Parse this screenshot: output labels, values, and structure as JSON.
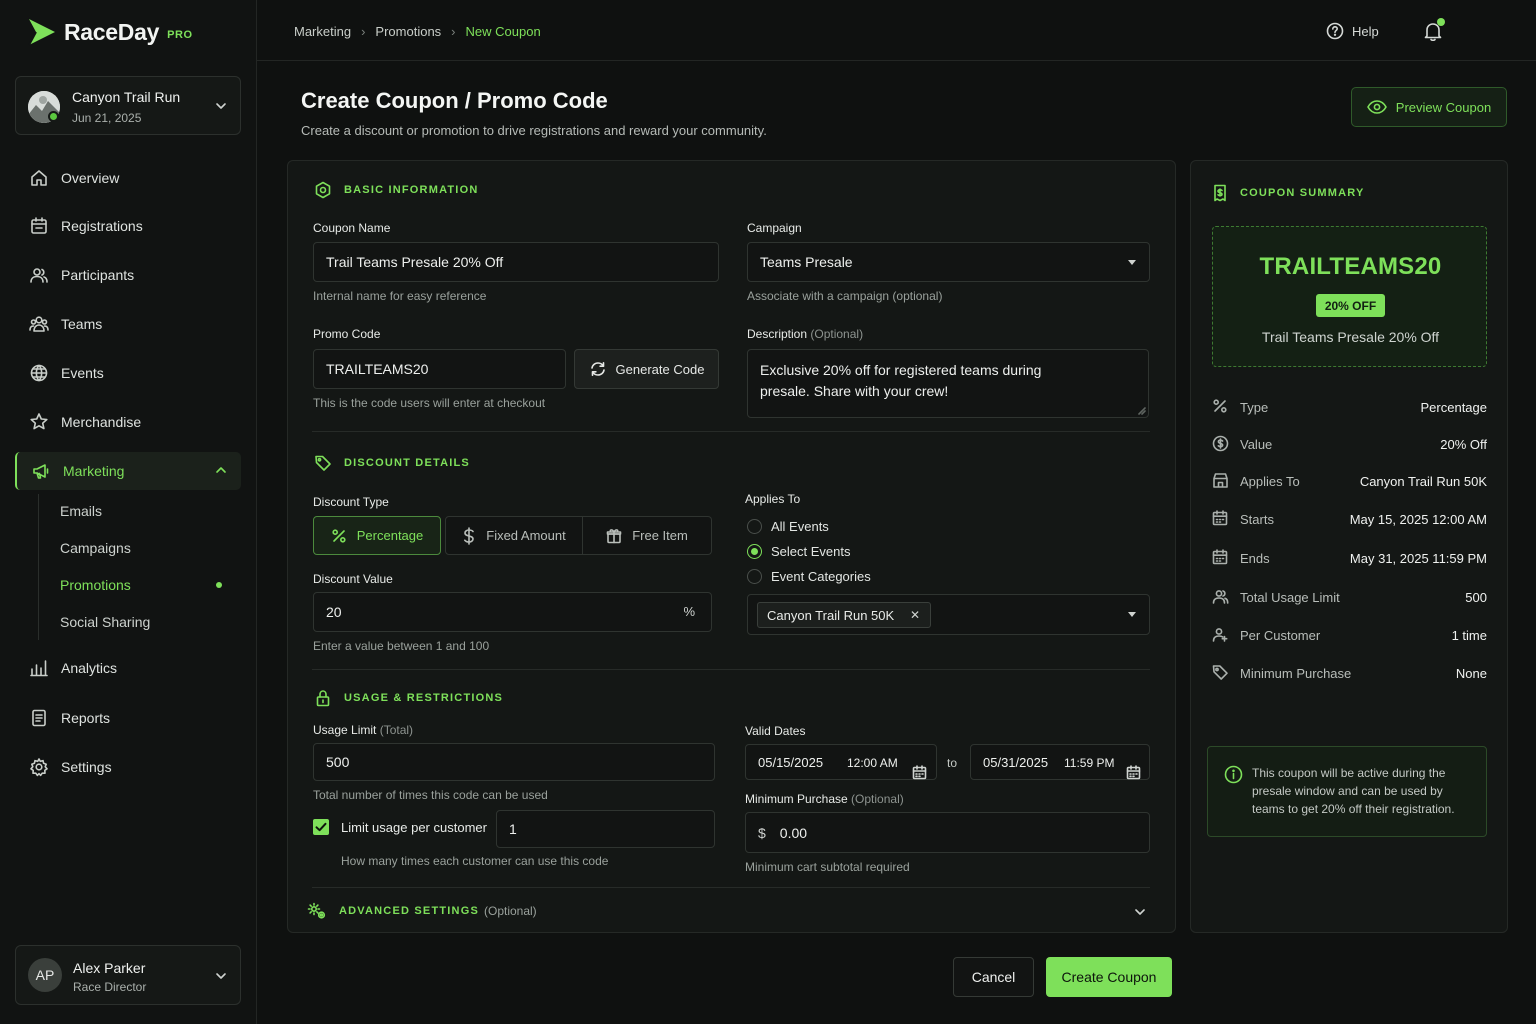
{
  "app": {
    "name": "RaceDay",
    "badge": "PRO"
  },
  "event": {
    "name": "Canyon Trail Run",
    "date": "Jun 21, 2025"
  },
  "nav": {
    "items": [
      {
        "label": "Overview",
        "icon": "home-icon"
      },
      {
        "label": "Registrations",
        "icon": "calendar-icon"
      },
      {
        "label": "Participants",
        "icon": "users-icon"
      },
      {
        "label": "Teams",
        "icon": "team-icon"
      },
      {
        "label": "Events",
        "icon": "globe-icon"
      },
      {
        "label": "Merchandise",
        "icon": "star-badge-icon"
      },
      {
        "label": "Marketing",
        "icon": "megaphone-icon"
      },
      {
        "label": "Analytics",
        "icon": "bar-chart-icon"
      },
      {
        "label": "Reports",
        "icon": "report-icon"
      },
      {
        "label": "Settings",
        "icon": "gear-icon"
      }
    ],
    "marketing_sub": [
      "Emails",
      "Campaigns",
      "Promotions",
      "Social Sharing"
    ]
  },
  "user": {
    "initials": "AP",
    "name": "Alex Parker",
    "role": "Race Director"
  },
  "breadcrumb": [
    "Marketing",
    "Promotions",
    "New Coupon"
  ],
  "topbar": {
    "help": "Help"
  },
  "page": {
    "title": "Create Coupon / Promo Code",
    "subtitle": "Create a discount or promotion to drive registrations and reward your community.",
    "preview_button": "Preview Coupon"
  },
  "basic": {
    "heading": "BASIC INFORMATION",
    "coupon_name_label": "Coupon Name",
    "coupon_name_value": "Trail Teams Presale 20% Off",
    "coupon_name_hint": "Internal name for easy reference",
    "campaign_label": "Campaign",
    "campaign_value": "Teams Presale",
    "campaign_hint": "Associate with a campaign (optional)",
    "promo_label": "Promo Code",
    "promo_value": "TRAILTEAMS20",
    "promo_hint": "This is the code users will enter at checkout",
    "generate_button": "Generate Code",
    "description_label": "Description",
    "description_opt": "(Optional)",
    "description_line1": "Exclusive 20% off for registered teams during",
    "description_line2": "presale. Share with your crew!"
  },
  "discount": {
    "heading": "DISCOUNT DETAILS",
    "type_label": "Discount Type",
    "types": [
      "Percentage",
      "Fixed Amount",
      "Free Item"
    ],
    "selected_type": "Percentage",
    "value_label": "Discount Value",
    "value": "20",
    "value_unit": "%",
    "value_hint": "Enter a value between 1 and 100",
    "applies_label": "Applies To",
    "applies_options": [
      "All Events",
      "Select Events",
      "Event Categories"
    ],
    "applies_selected": "Select Events",
    "selected_event_chip": "Canyon Trail Run 50K"
  },
  "usage": {
    "heading": "USAGE & RESTRICTIONS",
    "limit_label": "Usage Limit",
    "limit_opt": "(Total)",
    "limit_value": "500",
    "limit_hint": "Total number of times this code can be used",
    "per_customer_label": "Limit usage per customer",
    "per_customer_checked": true,
    "per_customer_value": "1",
    "per_customer_hint": "How many times each customer can use this code",
    "valid_label": "Valid Dates",
    "start_date": "05/15/2025",
    "start_time": "12:00 AM",
    "to": "to",
    "end_date": "05/31/2025",
    "end_time": "11:59 PM",
    "min_label": "Minimum Purchase",
    "min_opt": "(Optional)",
    "min_currency": "$",
    "min_value": "0.00",
    "min_hint": "Minimum cart subtotal required"
  },
  "advanced": {
    "heading": "ADVANCED SETTINGS",
    "opt": "(Optional)"
  },
  "summary": {
    "heading": "COUPON SUMMARY",
    "code": "TRAILTEAMS20",
    "badge": "20% OFF",
    "name": "Trail Teams Presale 20% Off",
    "rows": [
      {
        "key": "Type",
        "value": "Percentage",
        "icon": "percent-icon"
      },
      {
        "key": "Value",
        "value": "20% Off",
        "icon": "dollar-circle-icon"
      },
      {
        "key": "Applies To",
        "value": "Canyon Trail Run 50K",
        "icon": "store-icon"
      },
      {
        "key": "Starts",
        "value": "May 15, 2025 12:00 AM",
        "icon": "calendar-icon"
      },
      {
        "key": "Ends",
        "value": "May 31, 2025 11:59 PM",
        "icon": "calendar-icon"
      },
      {
        "key": "Total Usage Limit",
        "value": "500",
        "icon": "users-icon"
      },
      {
        "key": "Per Customer",
        "value": "1 time",
        "icon": "user-icon"
      },
      {
        "key": "Minimum Purchase",
        "value": "None",
        "icon": "tag-icon"
      }
    ],
    "info": "This coupon will be active during the presale window and can be used by teams to get 20% off their registration."
  },
  "actions": {
    "cancel": "Cancel",
    "create": "Create Coupon"
  },
  "colors": {
    "accent": "#7ee05a",
    "background": "#0f1110",
    "card": "#141715"
  }
}
